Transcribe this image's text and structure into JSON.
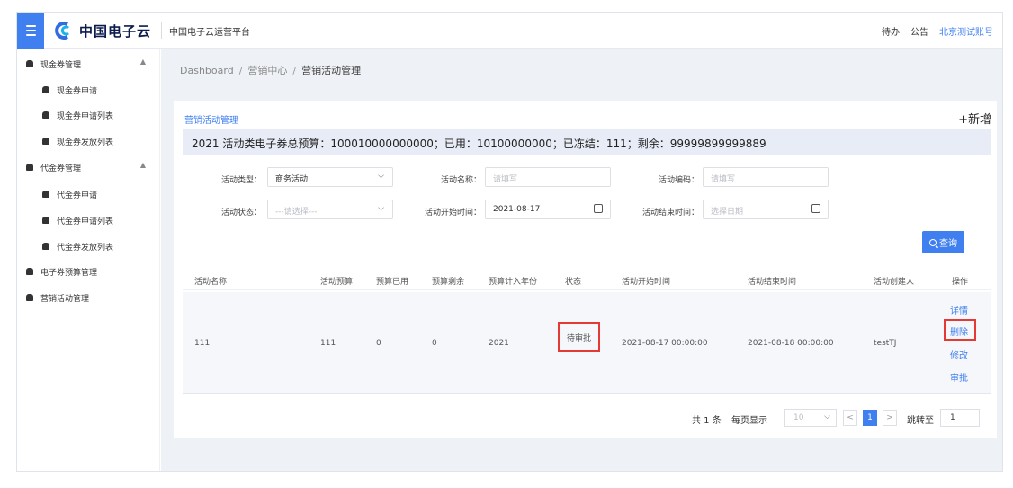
{
  "header": {
    "logo_text": "中国电子云",
    "platform_name": "中国电子云运营平台",
    "todo": "待办",
    "notice": "公告",
    "account": "北京测试账号"
  },
  "sidebar": {
    "groups": [
      {
        "label": "现金券管理",
        "caret": "▲",
        "items": [
          "现金券申请",
          "现金券申请列表",
          "现金券发放列表"
        ]
      },
      {
        "label": "代金券管理",
        "caret": "▲",
        "items": [
          "代金券申请",
          "代金券申请列表",
          "代金券发放列表"
        ]
      }
    ],
    "items": [
      "电子券预算管理",
      "营销活动管理"
    ]
  },
  "breadcrumb": {
    "items": [
      "Dashboard",
      "营销中心",
      "营销活动管理"
    ],
    "separator": "/"
  },
  "card": {
    "title": "营销活动管理",
    "add_label": "+新增",
    "budget_text": "2021 活动类电子券总预算：100010000000000；已用：10100000000；已冻结：111；剩余：99999899999889"
  },
  "filters": {
    "activity_type": {
      "label": "活动类型：",
      "value": "商务活动"
    },
    "activity_name": {
      "label": "活动名称：",
      "placeholder": "请填写"
    },
    "activity_code": {
      "label": "活动编码：",
      "placeholder": "请填写"
    },
    "activity_status": {
      "label": "活动状态：",
      "placeholder": "---请选择---"
    },
    "start_time": {
      "label": "活动开始时间：",
      "value": "2021-08-17"
    },
    "end_time": {
      "label": "活动结束时间：",
      "placeholder": "选择日期"
    },
    "query_label": "查询"
  },
  "table": {
    "columns": [
      "活动名称",
      "活动预算",
      "预算已用",
      "预算剩余",
      "预算计入年份",
      "状态",
      "活动开始时间",
      "活动结束时间",
      "活动创建人",
      "操作"
    ],
    "rows": [
      {
        "name": "111",
        "budget": "111",
        "used": "0",
        "remaining": "0",
        "year": "2021",
        "status": "待审批",
        "start": "2021-08-17 00:00:00",
        "end": "2021-08-18 00:00:00",
        "creator": "testTJ",
        "actions": [
          "详情",
          "删除",
          "修改",
          "审批"
        ]
      }
    ]
  },
  "pagination": {
    "total": "共 1 条",
    "per_page_label": "每页显示",
    "per_page": "10",
    "prev": "<",
    "page": "1",
    "next": ">",
    "jump_label": "跳转至",
    "jump_value": "1"
  },
  "colors": {
    "accent": "#3f7ff0",
    "highlight_box": "#e53935",
    "budget_bar": "#e8ecf6"
  },
  "icons": [
    "menu-icon",
    "brand-logo-icon",
    "car-icon",
    "chevron-down-icon",
    "calendar-icon",
    "search-icon"
  ]
}
